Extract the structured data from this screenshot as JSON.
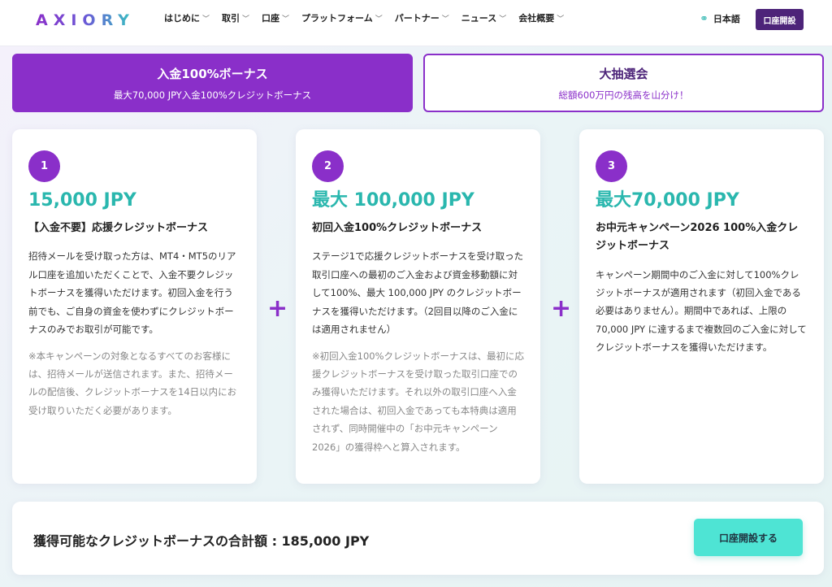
{
  "header": {
    "logo": "AXIORY",
    "nav": [
      {
        "label": "はじめに"
      },
      {
        "label": "取引"
      },
      {
        "label": "口座"
      },
      {
        "label": "プラットフォーム"
      },
      {
        "label": "パートナー"
      },
      {
        "label": "ニュース"
      },
      {
        "label": "会社概要"
      }
    ],
    "language": "日本語",
    "open_account": "口座開設"
  },
  "tabs": [
    {
      "title": "入金100%ボーナス",
      "subtitle": "最大70,000 JPY入金100%クレジットボーナス"
    },
    {
      "title": "大抽選会",
      "subtitle": "総額600万円の残高を山分け！"
    }
  ],
  "cards": [
    {
      "step": "1",
      "amount": "15,000 JPY",
      "title": "【入金不要】応援クレジットボーナス",
      "body": "招待メールを受け取った方は、MT4・MT5のリアル口座を追加いただくことで、入金不要クレジットボーナスを獲得いただけます。初回入金を行う前でも、ご自身の資金を使わずにクレジットボーナスのみでお取引が可能です。",
      "note": "※本キャンペーンの対象となるすべてのお客様には、招待メールが送信されます。また、招待メールの配信後、クレジットボーナスを14日以内にお受け取りいただく必要があります。"
    },
    {
      "step": "2",
      "amount": "最大 100,000 JPY",
      "title": "初回入金100%クレジットボーナス",
      "body": "ステージ1で応援クレジットボーナスを受け取った取引口座への最初のご入金および資金移動額に対して100%、最大 100,000 JPY のクレジットボーナスを獲得いただけます。（2回目以降のご入金には適用されません）",
      "note": "※初回入金100%クレジットボーナスは、最初に応援クレジットボーナスを受け取った取引口座でのみ獲得いただけます。それ以外の取引口座へ入金された場合は、初回入金であっても本特典は適用されず、同時開催中の「お中元キャンペーン2026」の獲得枠へと算入されます。"
    },
    {
      "step": "3",
      "amount": "最大70,000 JPY",
      "title": "お中元キャンペーン2026 100%入金クレジットボーナス",
      "body": "キャンペーン期間中のご入金に対して100%クレジットボーナスが適用されます（初回入金である必要はありません）。期間中であれば、上限の 70,000 JPY に達するまで複数回のご入金に対してクレジットボーナスを獲得いただけます。",
      "note": ""
    }
  ],
  "plus_sign": "+",
  "total": {
    "text": "獲得可能なクレジットボーナスの合計額 : 185,000 JPY",
    "cta": "口座開設する"
  },
  "colors": {
    "brand_purple": "#8a2fc9",
    "dark_purple": "#4d2479",
    "teal": "#2ab7ae",
    "cta_teal": "#4ee4d4"
  },
  "icons": {
    "chevron": "chevron-down-icon",
    "language": "globe-icon"
  }
}
